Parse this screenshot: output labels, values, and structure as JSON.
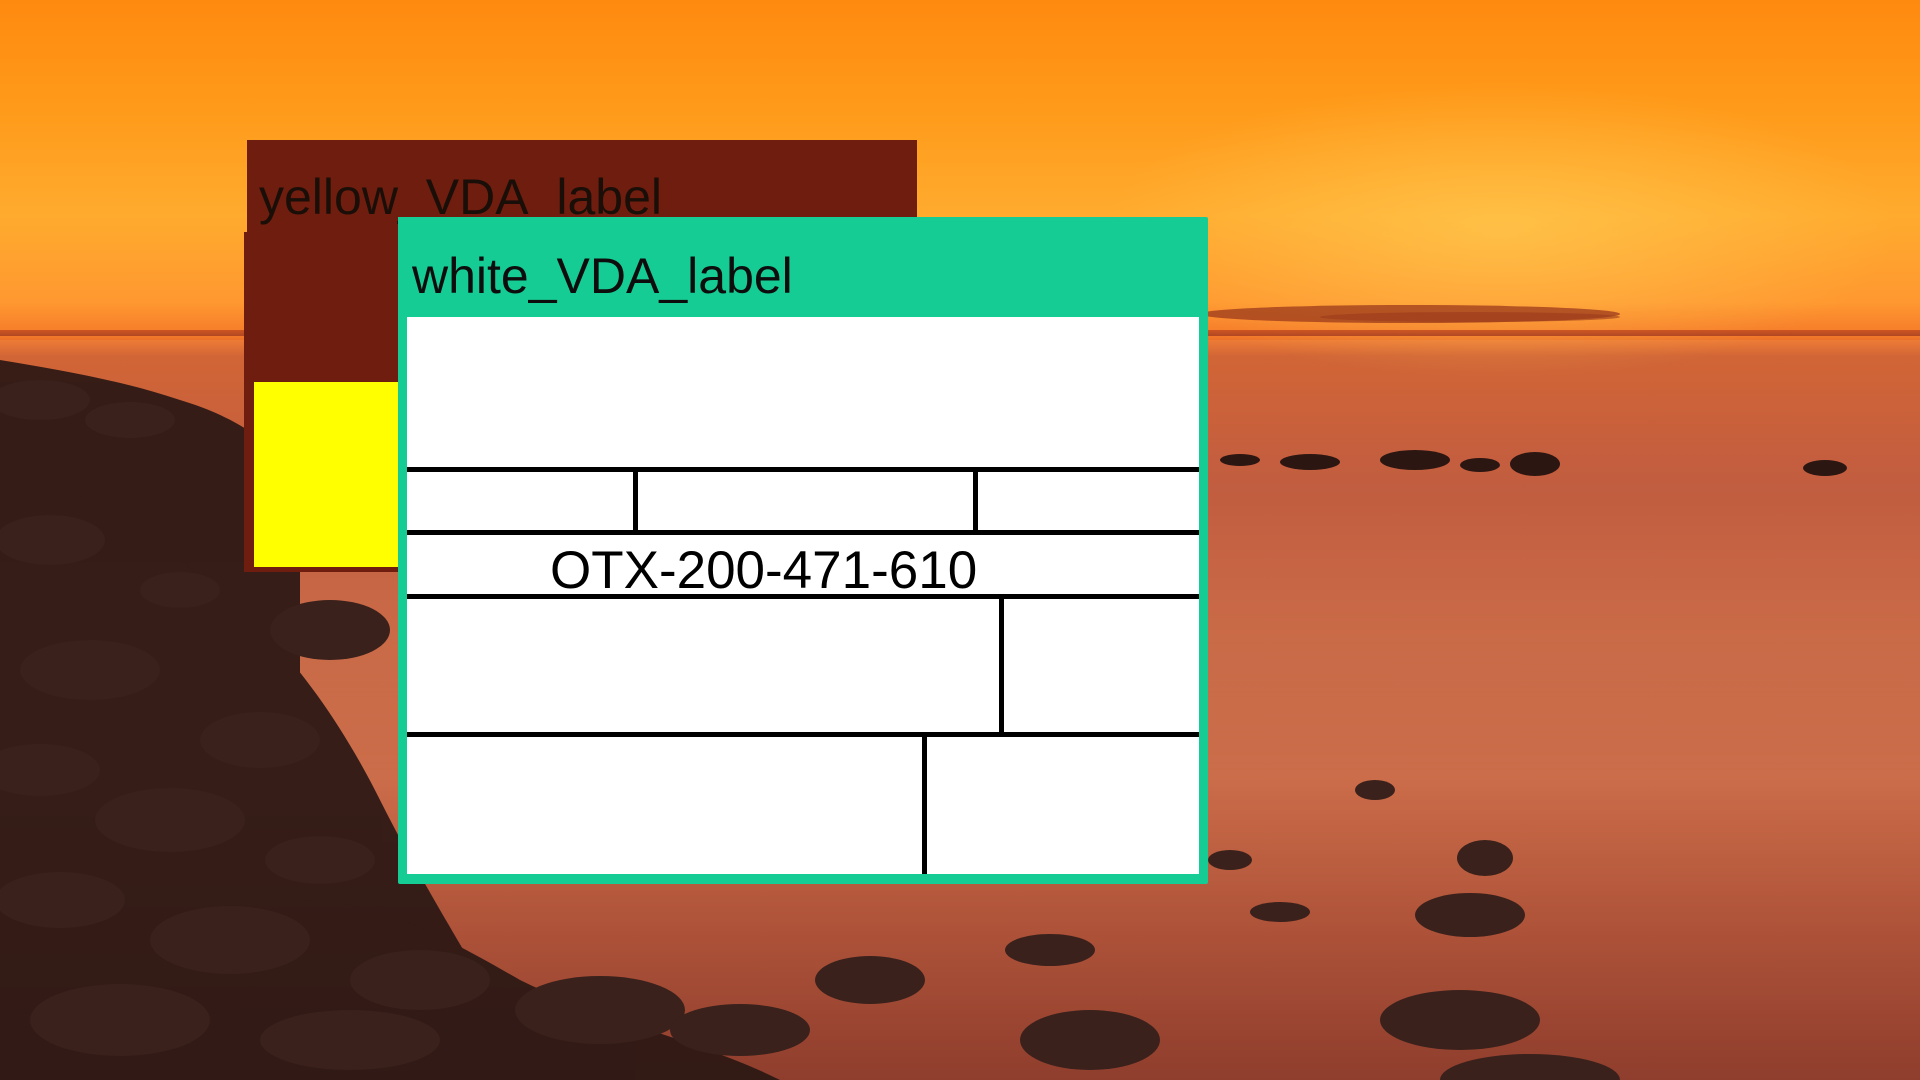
{
  "desktop": {
    "wallpaper": "sunset-over-rocky-sea"
  },
  "windows": [
    {
      "id": "yellow",
      "title": "yellow_VDA_label",
      "titlebar_color": "#6f1d0e",
      "fill_color": "#ffff00"
    },
    {
      "id": "white",
      "title": "white_VDA_label",
      "titlebar_color": "#15cd94",
      "fill_color": "#ffffff",
      "label": {
        "serial_number": "OTX-200-471-610"
      }
    }
  ]
}
